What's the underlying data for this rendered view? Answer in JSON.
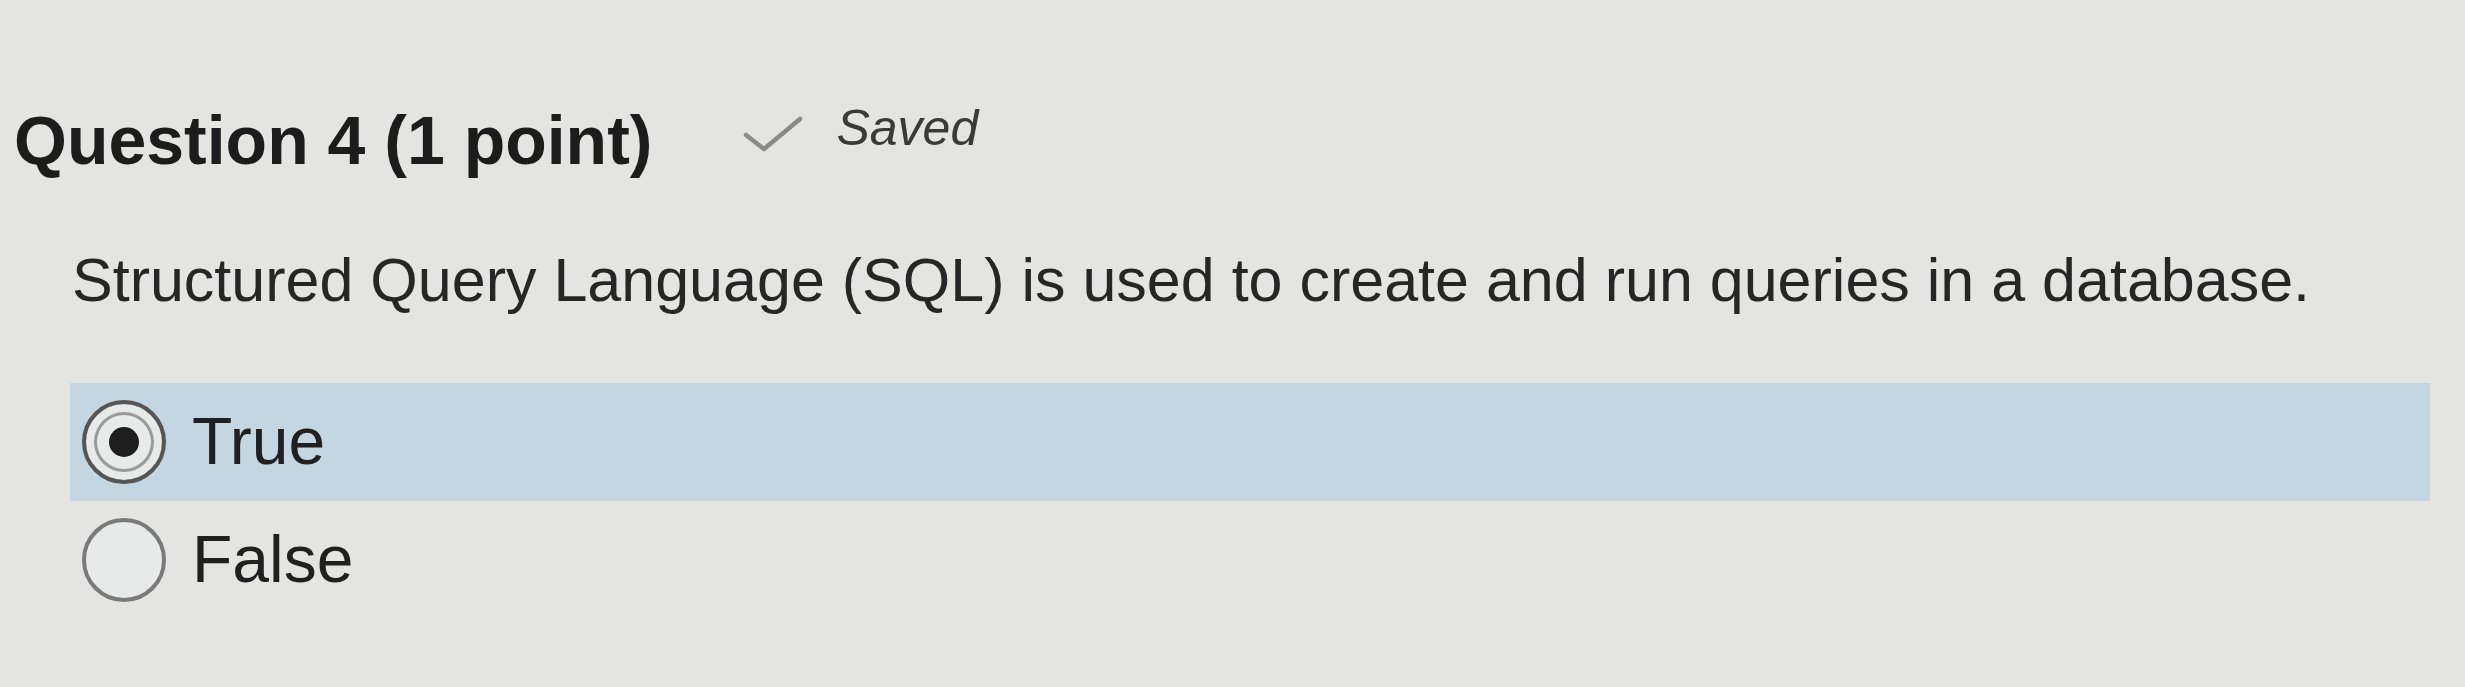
{
  "question": {
    "title": "Question 4 (1 point)",
    "save_status": "Saved",
    "prompt": "Structured Query Language (SQL) is used to create and run queries in a database."
  },
  "options": [
    {
      "label": "True",
      "selected": true
    },
    {
      "label": "False",
      "selected": false
    }
  ]
}
